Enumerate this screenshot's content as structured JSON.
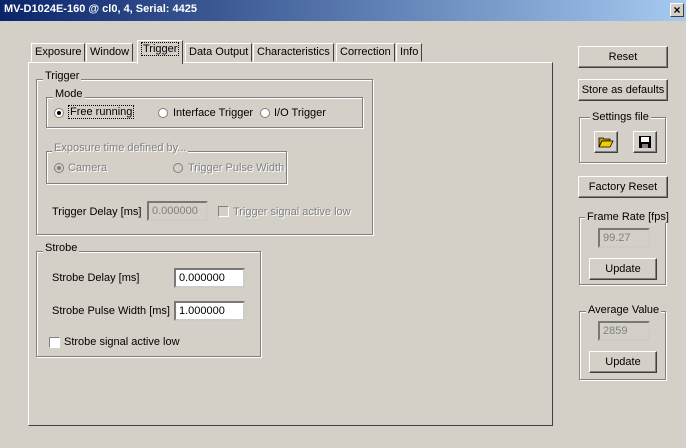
{
  "window": {
    "title": "MV-D1024E-160 @ cl0, 4, Serial: 4425",
    "close": "×"
  },
  "tabs": [
    "Exposure",
    "Window",
    "Trigger",
    "Data Output",
    "Characteristics",
    "Correction",
    "Info"
  ],
  "active_tab": "Trigger",
  "trigger": {
    "group": "Trigger",
    "mode": {
      "label": "Mode",
      "options": [
        "Free running",
        "Interface Trigger",
        "I/O Trigger"
      ],
      "selected": "Free running"
    },
    "exposure": {
      "label": "Exposure time defined by...",
      "options": [
        "Camera",
        "Trigger Pulse Width"
      ],
      "selected": "Camera"
    },
    "delay": {
      "label": "Trigger Delay [ms]",
      "value": "0.000000"
    },
    "active_low": {
      "label": "Trigger signal active low",
      "checked": false
    }
  },
  "strobe": {
    "group": "Strobe",
    "delay": {
      "label": "Strobe Delay [ms]",
      "value": "0.000000"
    },
    "pulse_width": {
      "label": "Strobe Pulse Width [ms]",
      "value": "1.000000"
    },
    "active_low": {
      "label": "Strobe signal active low",
      "checked": false
    }
  },
  "side": {
    "reset": "Reset",
    "store_defaults": "Store as defaults",
    "settings_file": "Settings file",
    "factory_reset": "Factory Reset",
    "frame_rate": {
      "label": "Frame Rate [fps]",
      "value": "99.27",
      "update": "Update"
    },
    "average": {
      "label": "Average Value",
      "value": "2859",
      "update": "Update"
    }
  }
}
